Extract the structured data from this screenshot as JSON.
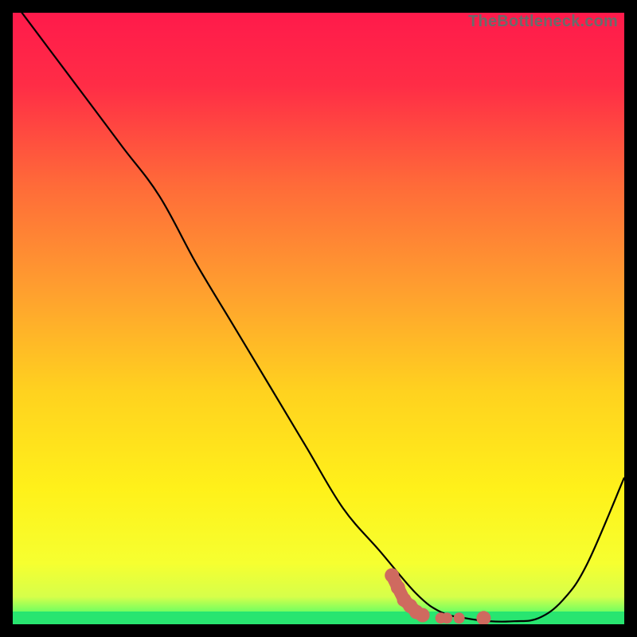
{
  "watermark": {
    "text": "TheBottleneck.com"
  },
  "colors": {
    "gradient_stops": [
      {
        "offset": 0.0,
        "color": "#ff1a4b"
      },
      {
        "offset": 0.12,
        "color": "#ff2d46"
      },
      {
        "offset": 0.28,
        "color": "#ff6a39"
      },
      {
        "offset": 0.45,
        "color": "#ff9e2f"
      },
      {
        "offset": 0.62,
        "color": "#ffd21f"
      },
      {
        "offset": 0.78,
        "color": "#fff11a"
      },
      {
        "offset": 0.9,
        "color": "#f6ff30"
      },
      {
        "offset": 0.955,
        "color": "#d6ff4a"
      },
      {
        "offset": 0.985,
        "color": "#5cff66"
      },
      {
        "offset": 1.0,
        "color": "#22e86b"
      }
    ],
    "line": "#000000",
    "marker": "#cf6a5f",
    "green_band": "#28e570"
  },
  "chart_data": {
    "type": "line",
    "title": "",
    "xlabel": "",
    "ylabel": "",
    "xlim": [
      0,
      100
    ],
    "ylim": [
      0,
      100
    ],
    "series": [
      {
        "name": "bottleneck-curve",
        "x": [
          0,
          6,
          12,
          18,
          24,
          30,
          36,
          42,
          48,
          54,
          60,
          66,
          70,
          74,
          78,
          82,
          86,
          90,
          94,
          100
        ],
        "y": [
          102,
          94,
          86,
          78,
          70,
          59,
          49,
          39,
          29,
          19,
          12,
          5,
          2,
          1,
          0.5,
          0.5,
          1,
          4,
          10,
          24
        ]
      }
    ],
    "markers": {
      "name": "highlight-cluster",
      "x": [
        62,
        63,
        64,
        65,
        66,
        67,
        70,
        71,
        73,
        77
      ],
      "y": [
        8,
        6,
        4,
        3,
        2,
        1.5,
        1,
        1,
        1,
        1
      ]
    },
    "annotations": []
  }
}
